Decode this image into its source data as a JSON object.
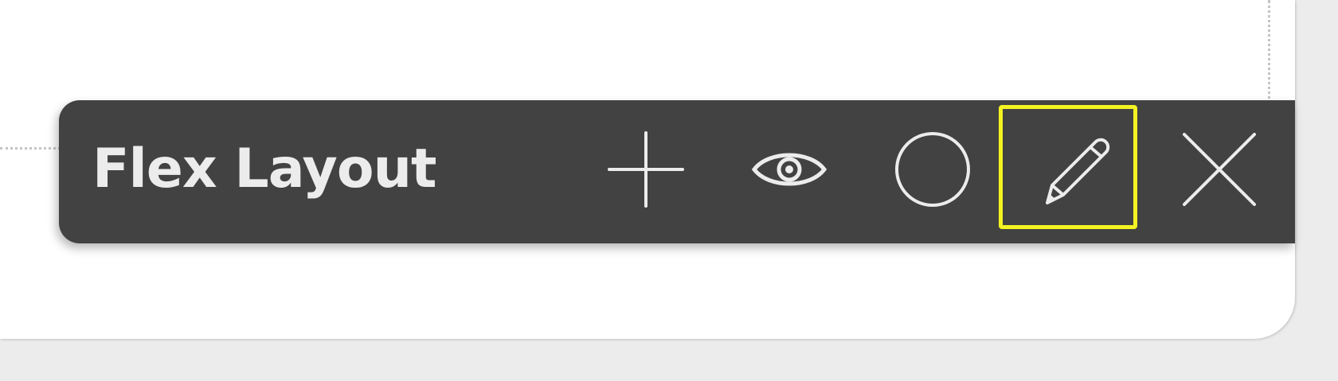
{
  "toolbar": {
    "title": "Flex Layout",
    "buttons": [
      {
        "name": "add",
        "icon": "plus-icon"
      },
      {
        "name": "visibility",
        "icon": "eye-icon"
      },
      {
        "name": "circle",
        "icon": "circle-icon"
      },
      {
        "name": "edit",
        "icon": "pencil-icon",
        "highlighted": true
      },
      {
        "name": "close",
        "icon": "close-icon"
      }
    ]
  },
  "colors": {
    "toolbar_bg": "#424242",
    "icon_color": "#ececec",
    "highlight": "#f3f322",
    "canvas_bg": "#ffffff",
    "page_bg": "#ececec"
  }
}
